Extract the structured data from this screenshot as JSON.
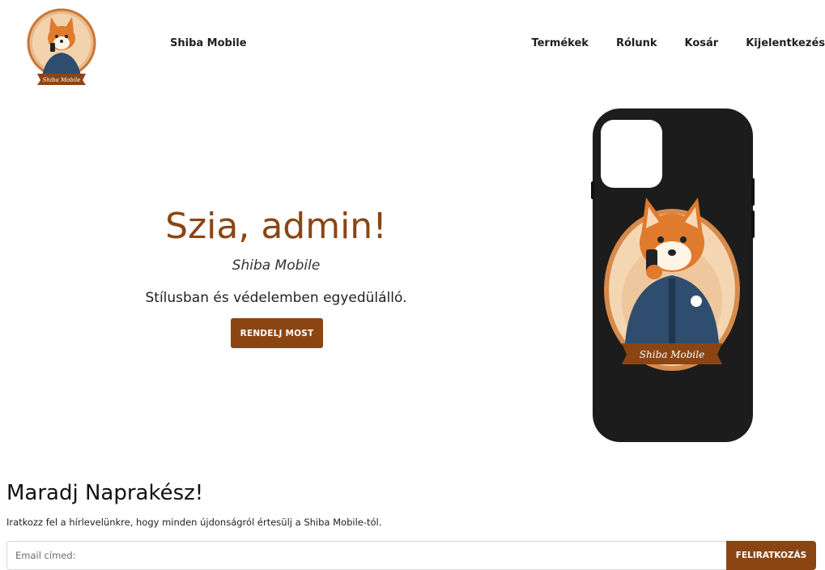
{
  "nav": {
    "brand": "Shiba Mobile",
    "links": [
      "Termékek",
      "Rólunk",
      "Kosár",
      "Kijelentkezés"
    ],
    "logo_icon": "shiba-logo-icon"
  },
  "hero": {
    "title": "Szia, admin!",
    "subtitle": "Shiba Mobile",
    "tagline": "Stílusban és védelemben egyedülálló.",
    "cta_label": "RENDELJ MOST",
    "image_icon": "phone-case-shiba-image",
    "image_text": "Shiba Mobile"
  },
  "newsletter": {
    "title": "Maradj Naprakész!",
    "text": "Iratkozz fel a hírlevelünkre, hogy minden újdonságról értesülj a Shiba Mobile-tól.",
    "email_placeholder": "Email címed:",
    "button_label": "FELIRATKOZÁS"
  },
  "colors": {
    "accent": "#8b4513",
    "phone_case": "#1c1c1c",
    "shiba_orange": "#e07a2c",
    "jacket": "#2f4d6e"
  }
}
